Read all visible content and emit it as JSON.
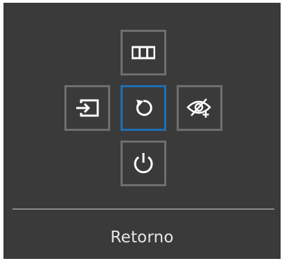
{
  "joystick_menu": {
    "buttons": {
      "up": {
        "icon": "picture-mode-icon"
      },
      "left": {
        "icon": "source-input-icon"
      },
      "center": {
        "icon": "return-icon",
        "selected": true
      },
      "right": {
        "icon": "eye-comfort-icon"
      },
      "down": {
        "icon": "power-icon"
      }
    },
    "status_label": "Retorno"
  },
  "colors": {
    "panel_background": "#3a3a3a",
    "button_border": "#6f6f6f",
    "selected_border": "#1f6fb4",
    "icon_color": "#ffffff",
    "label_color": "#e6e6e6",
    "divider_color": "#8a8a8a"
  }
}
